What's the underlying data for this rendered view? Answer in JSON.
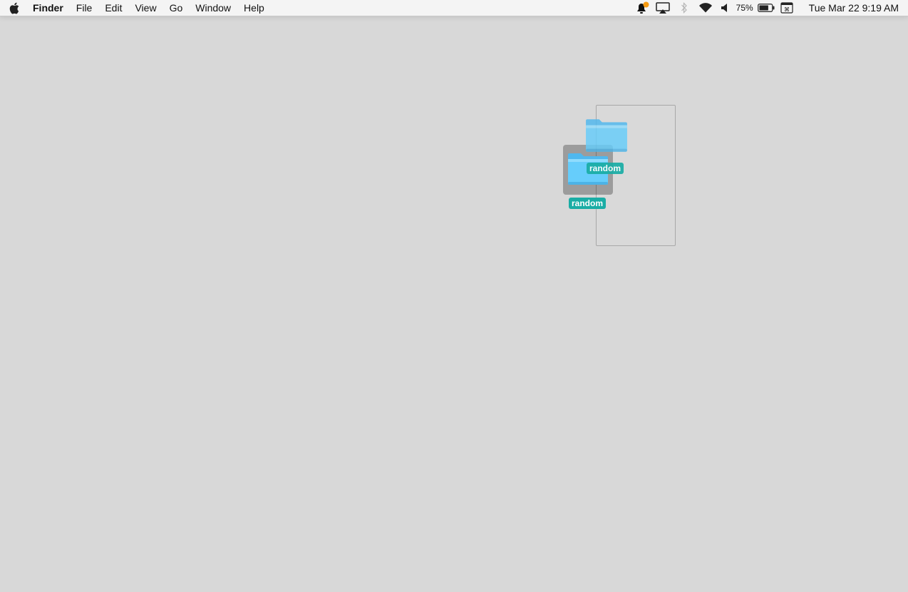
{
  "menubar": {
    "apple_icon": "apple-logo-icon",
    "items": [
      {
        "label": "Finder"
      },
      {
        "label": "File"
      },
      {
        "label": "Edit"
      },
      {
        "label": "View"
      },
      {
        "label": "Go"
      },
      {
        "label": "Window"
      },
      {
        "label": "Help"
      }
    ],
    "status": {
      "notification_icon": "notification-bell-icon",
      "airplay_icon": "airplay-icon",
      "bluetooth_icon": "bluetooth-icon",
      "wifi_icon": "wifi-icon",
      "volume_icon": "volume-icon",
      "battery_percent": "75%",
      "battery_level": 0.75,
      "input_icon": "keyboard-input-icon",
      "clock": "Tue Mar 22  9:19 AM"
    }
  },
  "desktop": {
    "folders": [
      {
        "name": "random",
        "state": "selected"
      },
      {
        "name": "random",
        "state": "dragging-ghost"
      }
    ]
  },
  "colors": {
    "desktop_bg": "#d8d8d8",
    "label_bg": "#1aada5",
    "folder_blue": "#5ac8fa"
  }
}
